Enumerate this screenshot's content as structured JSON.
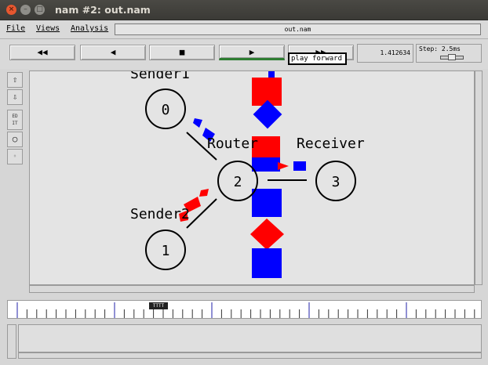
{
  "window": {
    "title": "nam #2: out.nam",
    "close_glyph": "×",
    "min_glyph": "–",
    "max_glyph": "□"
  },
  "menubar": {
    "items": [
      "File",
      "Views",
      "Analysis"
    ],
    "filename": "out.nam"
  },
  "toolbar": {
    "rewind_glyph": "◀◀",
    "back_glyph": "◀",
    "stop_glyph": "■",
    "play_glyph": "▶",
    "ff_glyph": "▶▶",
    "tooltip": "play forward",
    "time": "1.412634",
    "step_label": "Step: 2.5ms"
  },
  "tools": {
    "ed_label": "ED IT"
  },
  "network": {
    "nodes": [
      {
        "id": "0",
        "label": "Sender1"
      },
      {
        "id": "1",
        "label": "Sender2"
      },
      {
        "id": "2",
        "label": "Router"
      },
      {
        "id": "3",
        "label": "Receiver"
      }
    ]
  },
  "timeline": {
    "marker": "TTTT"
  },
  "colors": {
    "flow_red": "#ff0000",
    "flow_blue": "#0000ff",
    "play_indicator": "#2e7d32"
  }
}
